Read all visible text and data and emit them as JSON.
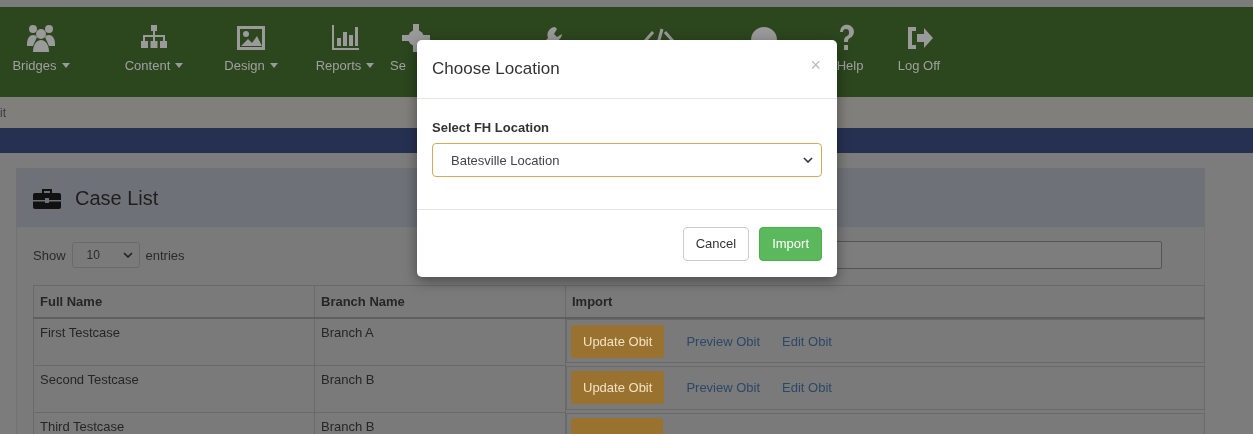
{
  "nav": {
    "items": [
      {
        "label": "Bridges",
        "dropdown": true
      },
      {
        "label": "Content",
        "dropdown": true
      },
      {
        "label": "Design",
        "dropdown": true
      },
      {
        "label": "Reports",
        "dropdown": true
      },
      {
        "label": "Se",
        "dropdown": false
      },
      {
        "dropdown": false
      },
      {
        "dropdown": false
      },
      {
        "dropdown": false
      },
      {
        "label": "Help",
        "dropdown": false
      },
      {
        "label": "Log Off",
        "dropdown": false
      }
    ]
  },
  "breadcrumb": "it",
  "panel": {
    "title": "Case List",
    "length": {
      "before": "Show",
      "value": "10",
      "after": "entries"
    },
    "table": {
      "columns": [
        "Full Name",
        "Branch Name",
        "Import"
      ],
      "rows": [
        {
          "full_name": "First Testcase",
          "branch": "Branch A",
          "actions": [
            "Update Obit",
            "Preview Obit",
            "Edit Obit"
          ]
        },
        {
          "full_name": "Second Testcase",
          "branch": "Branch B",
          "actions": [
            "Update Obit",
            "Preview Obit",
            "Edit Obit"
          ]
        },
        {
          "full_name": "Third Testcase",
          "branch": "Branch B"
        }
      ]
    }
  },
  "modal": {
    "title": "Choose Location",
    "close": "×",
    "field_label": "Select FH Location",
    "value": "Batesville Location",
    "buttons": [
      {
        "label": "Cancel",
        "kind": "default"
      },
      {
        "label": "Import",
        "kind": "primary"
      }
    ]
  }
}
